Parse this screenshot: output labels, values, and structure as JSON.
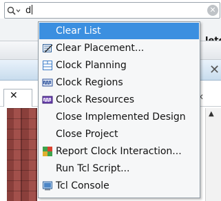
{
  "search": {
    "value": "d",
    "clear_glyph": "✕",
    "icon": "search-icon"
  },
  "background": {
    "peek_label": "lete",
    "titlebar_close": "✕",
    "tab_close": "✕",
    "tab_peek_close": "✕",
    "scroll_up": "▲"
  },
  "dropdown": {
    "items": [
      {
        "label": "Clear List",
        "icon": "",
        "selected": true
      },
      {
        "label": "Clear Placement...",
        "icon": "placement-icon"
      },
      {
        "label": "Clock Planning",
        "icon": "clock-planning-icon"
      },
      {
        "label": "Clock Regions",
        "icon": "clock-regions-icon"
      },
      {
        "label": "Clock Resources",
        "icon": "clock-resources-icon"
      },
      {
        "label": "Close Implemented Design",
        "icon": ""
      },
      {
        "label": "Close Project",
        "icon": ""
      },
      {
        "label": "Report Clock Interaction...",
        "icon": "clock-interaction-icon"
      },
      {
        "label": "Run Tcl Script...",
        "icon": ""
      },
      {
        "label": "Tcl Console",
        "icon": "tcl-console-icon"
      }
    ]
  },
  "colors": {
    "selection": "#3b8fe0",
    "menu_bg": "#f6f7f8"
  }
}
